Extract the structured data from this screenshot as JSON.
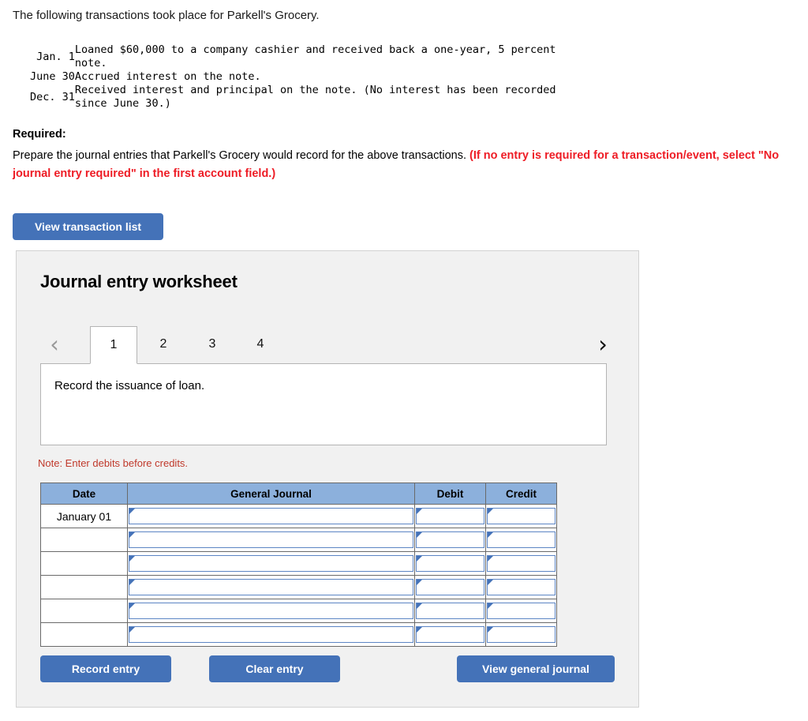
{
  "intro": {
    "text": "The following transactions took place for Parkell's Grocery."
  },
  "transactions": [
    {
      "date": "Jan. 1",
      "description": "Loaned $60,000 to a company cashier and received back a one-year, 5 percent\nnote."
    },
    {
      "date": "June 30",
      "description": "Accrued interest on the note."
    },
    {
      "date": "Dec. 31",
      "description": "Received interest and principal on the note. (No interest has been recorded\nsince June 30.)"
    }
  ],
  "required": {
    "label": "Required:",
    "body_plain": "Prepare the journal entries that Parkell's Grocery would record for the above transactions. ",
    "body_red": "(If no entry is required for a transaction/event, select \"No journal entry required\" in the first account field.)"
  },
  "buttons": {
    "view_transaction_list": "View transaction list",
    "record_entry": "Record entry",
    "clear_entry": "Clear entry",
    "view_general_journal": "View general journal"
  },
  "worksheet": {
    "title": "Journal entry worksheet",
    "prev_icon": "‹",
    "next_icon": "›",
    "tabs": [
      {
        "label": "1",
        "active": true
      },
      {
        "label": "2",
        "active": false
      },
      {
        "label": "3",
        "active": false
      },
      {
        "label": "4",
        "active": false
      }
    ],
    "description": "Record the issuance of loan.",
    "note": "Note: Enter debits before credits.",
    "table": {
      "headers": [
        "Date",
        "General Journal",
        "Debit",
        "Credit"
      ],
      "rows": [
        {
          "date": "January 01",
          "general_journal": "",
          "debit": "",
          "credit": ""
        },
        {
          "date": "",
          "general_journal": "",
          "debit": "",
          "credit": ""
        },
        {
          "date": "",
          "general_journal": "",
          "debit": "",
          "credit": ""
        },
        {
          "date": "",
          "general_journal": "",
          "debit": "",
          "credit": ""
        },
        {
          "date": "",
          "general_journal": "",
          "debit": "",
          "credit": ""
        },
        {
          "date": "",
          "general_journal": "",
          "debit": "",
          "credit": ""
        }
      ]
    }
  },
  "colors": {
    "button_blue": "#4472b8",
    "header_blue": "#8cb0dc",
    "alert_red": "#ee1c25",
    "note_red": "#c0392b",
    "panel_bg": "#f1f1f1"
  }
}
